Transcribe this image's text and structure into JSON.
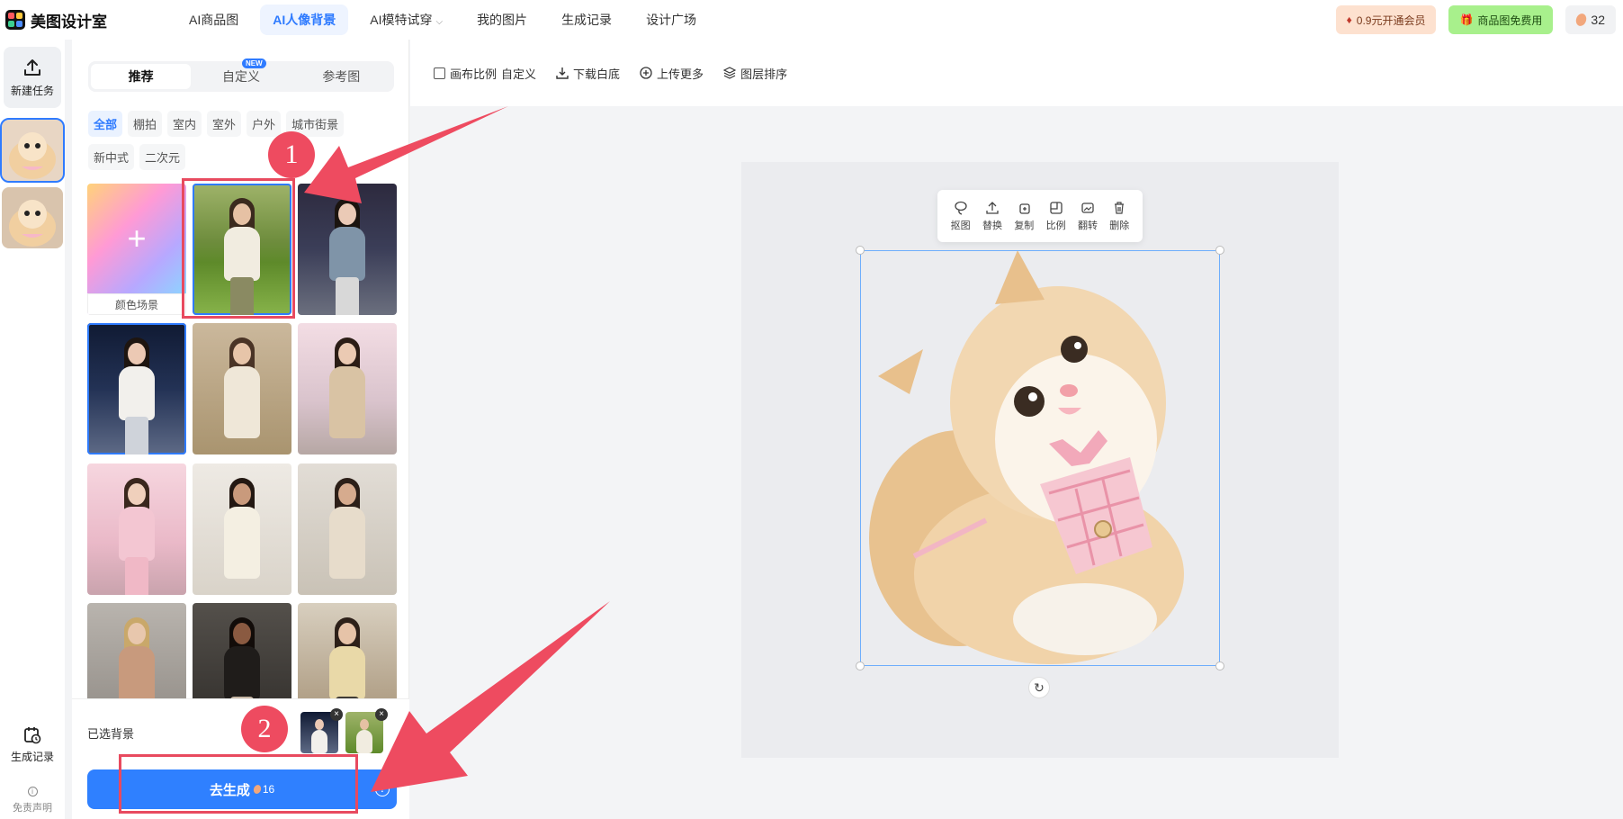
{
  "app": {
    "name": "美图设计室"
  },
  "nav": {
    "items": [
      {
        "label": "AI商品图",
        "active": false
      },
      {
        "label": "AI人像背景",
        "active": true
      },
      {
        "label": "AI模特试穿",
        "active": false,
        "dropdown": true
      },
      {
        "label": "我的图片",
        "active": false
      },
      {
        "label": "生成记录",
        "active": false
      },
      {
        "label": "设计广场",
        "active": false
      }
    ]
  },
  "header_right": {
    "vip_label": "0.9元开通会员",
    "free_label": "商品图免费用",
    "beans_count": "32"
  },
  "rail": {
    "new_task_label": "新建任务",
    "history_label": "生成记录",
    "disclaimer_label": "免责声明"
  },
  "panel": {
    "tabs": [
      {
        "label": "推荐",
        "active": true
      },
      {
        "label": "自定义",
        "active": false,
        "badge": "NEW"
      },
      {
        "label": "参考图",
        "active": false
      }
    ],
    "filters": [
      "全部",
      "棚拍",
      "室内",
      "室外",
      "户外",
      "城市街景",
      "新中式",
      "二次元"
    ],
    "active_filter": "全部",
    "color_scene_label": "颜色场景",
    "selected_bg_label": "已选背景",
    "generate_label": "去生成",
    "generate_cost": "16"
  },
  "toolbar": {
    "ratio_label": "画布比例",
    "ratio_value": "自定义",
    "download_label": "下载白底",
    "upload_label": "上传更多",
    "layer_label": "图层排序"
  },
  "float_tools": [
    "抠图",
    "替换",
    "复制",
    "比例",
    "翻转",
    "删除"
  ],
  "annotations": {
    "step1": "1",
    "step2": "2"
  },
  "colors": {
    "accent": "#2f7bff",
    "annotation": "#ee4b60"
  }
}
